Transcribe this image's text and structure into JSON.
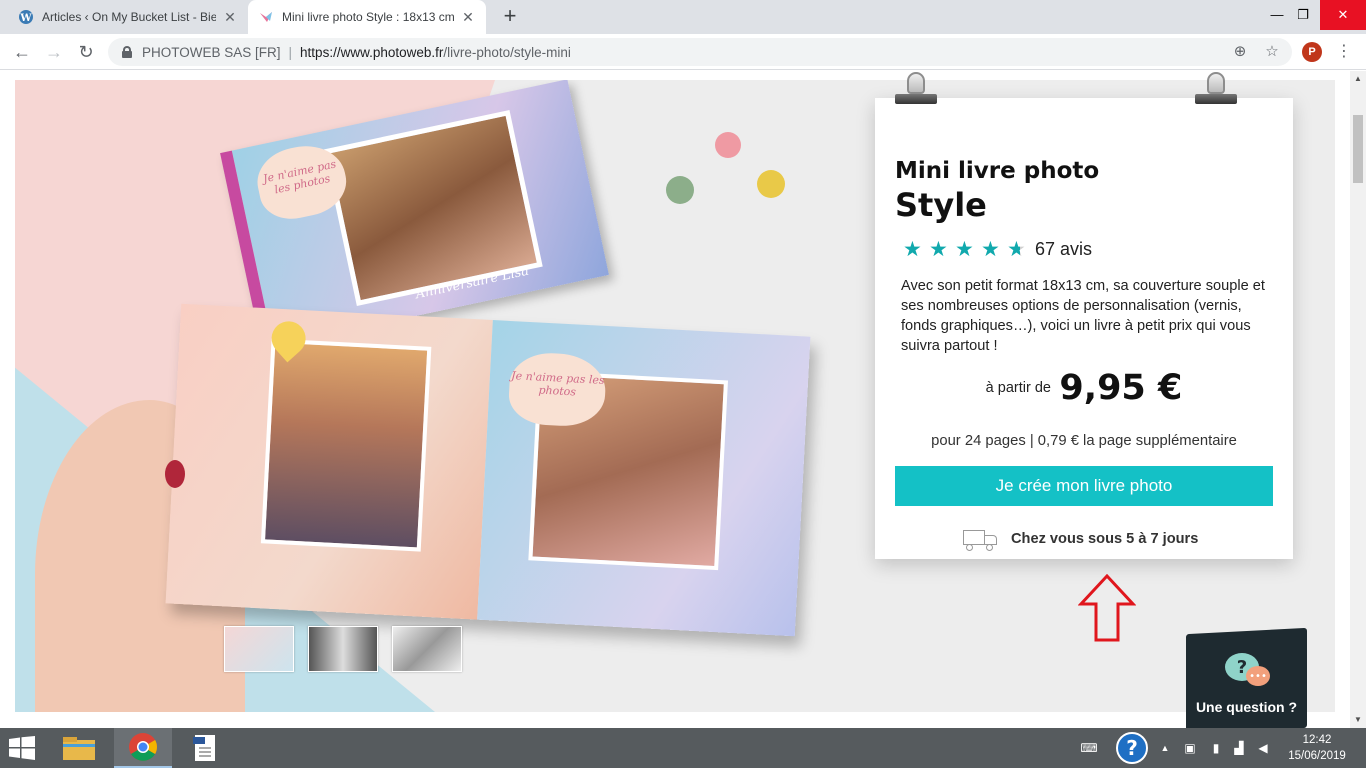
{
  "browser": {
    "tabs": [
      {
        "title": "Articles ‹ On My Bucket List - Bie",
        "active": false
      },
      {
        "title": "Mini livre photo Style : 18x13 cm",
        "active": true
      }
    ],
    "new_tab": "+",
    "window_controls": {
      "minimize": "—",
      "restore": "❐",
      "close": "✕"
    },
    "address": {
      "org": "PHOTOWEB SAS [FR]",
      "separator": "|",
      "url_host": "https://www.photoweb.fr",
      "url_path": "/livre-photo/style-mini"
    },
    "profile_initial": "P"
  },
  "product": {
    "subtitle": "Mini livre photo",
    "name": "Style",
    "rating": 4.5,
    "reviews": "67 avis",
    "description": "Avec son petit format 18x13 cm, sa couverture souple et ses nombreuses options de personnalisation (vernis, fonds graphiques…), voici un livre à petit prix qui vous suivra partout !",
    "price_from": "à partir de",
    "price": "9,95 €",
    "pages_info": "pour 24 pages | 0,79 €  la page supplémentaire",
    "cta": "Je crée mon livre photo",
    "delivery": "Chez vous sous 5 à 7 jours"
  },
  "gallery": {
    "cover_caption": "Anniversaire Lisa",
    "bubble_text": "Je n'aime pas les photos",
    "thumbnails": [
      "thumb-1",
      "thumb-2",
      "thumb-3"
    ]
  },
  "help_widget": {
    "label": "Une question ?"
  },
  "taskbar": {
    "clock_time": "12:42",
    "clock_date": "15/06/2019"
  },
  "colors": {
    "accent": "#14c1c6",
    "star": "#11a9ad",
    "annotation_arrow": "#e0161d"
  }
}
